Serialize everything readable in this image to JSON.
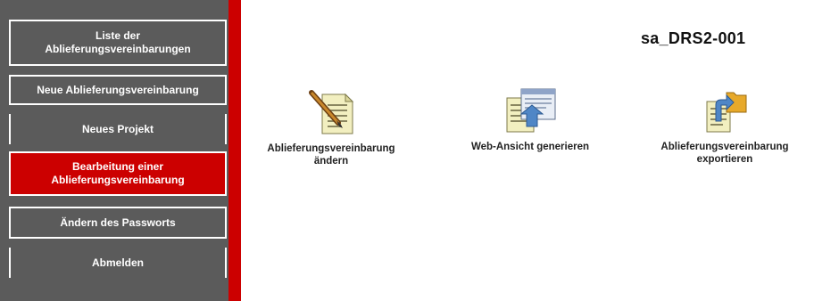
{
  "sidebar": {
    "items": [
      {
        "line1": "Liste der",
        "line2": "Ablieferungsvereinbarungen"
      },
      {
        "line1": "Neue Ablieferungsvereinbarung"
      },
      {
        "line1": "Neues Projekt"
      },
      {
        "line1": "Bearbeitung einer",
        "line2": "Ablieferungsvereinbarung"
      },
      {
        "line1": "Ändern des Passworts"
      },
      {
        "line1": "Abmelden"
      }
    ]
  },
  "main": {
    "title": "sa_DRS2-001",
    "actions": [
      {
        "icon": "pencil-document-icon",
        "line1": "Ablieferungsvereinbarung",
        "line2": "ändern"
      },
      {
        "icon": "web-view-icon",
        "line1": "Web-Ansicht generieren"
      },
      {
        "icon": "export-icon",
        "line1": "Ablieferungsvereinbarung",
        "line2": "exportieren"
      }
    ]
  },
  "colors": {
    "sidebar_bg": "#5b5b5b",
    "accent_red": "#cc0000",
    "text_white": "#ffffff"
  }
}
